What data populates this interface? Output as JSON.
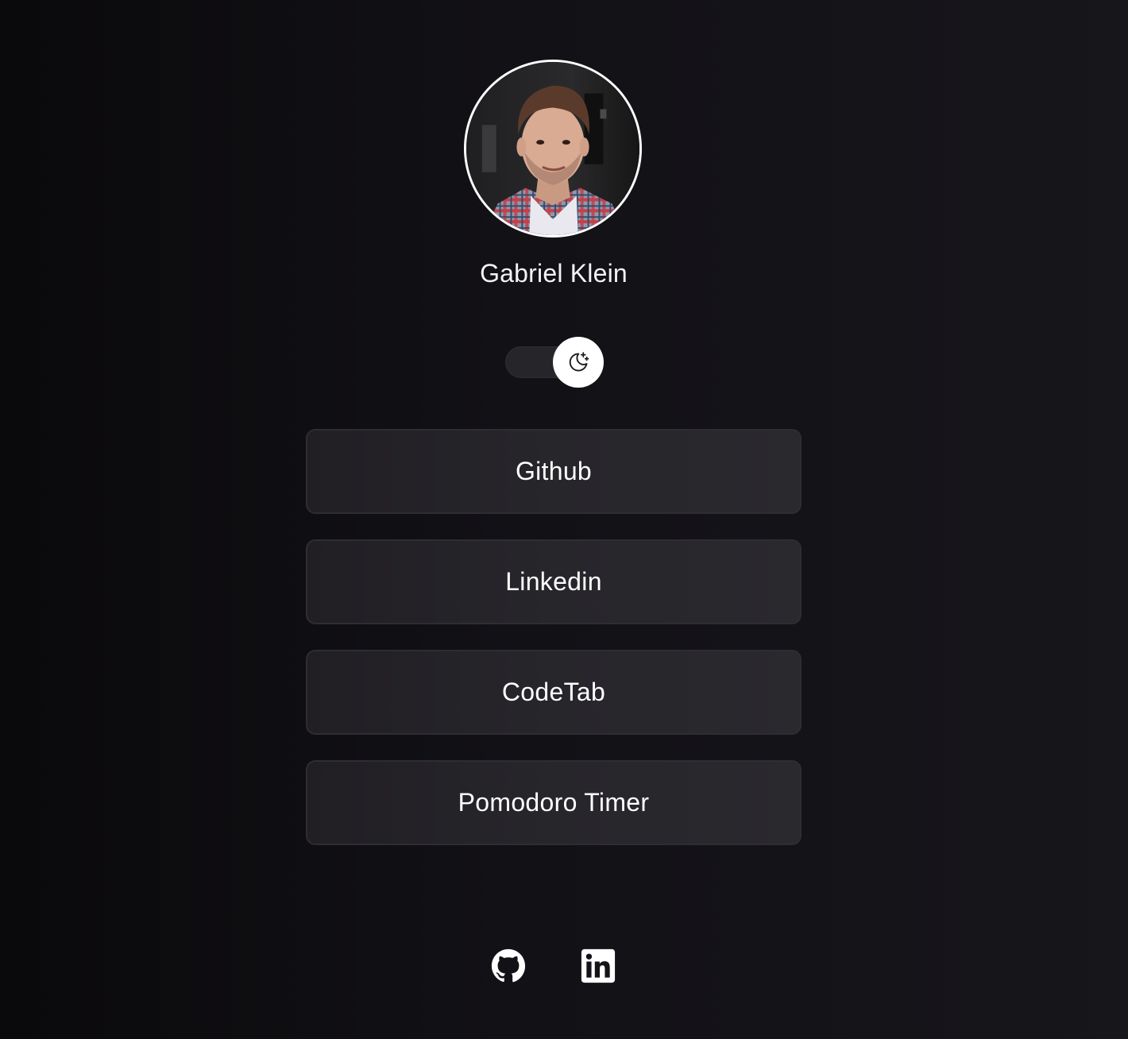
{
  "profile": {
    "name": "Gabriel Klein",
    "avatar_icon": "profile-photo"
  },
  "theme_toggle": {
    "state": "dark",
    "icon": "moon-stars-icon"
  },
  "links": [
    {
      "label": "Github"
    },
    {
      "label": "Linkedin"
    },
    {
      "label": "CodeTab"
    },
    {
      "label": "Pomodoro Timer"
    }
  ],
  "footer": {
    "icons": [
      "github-icon",
      "linkedin-icon"
    ]
  },
  "colors": {
    "background": "#121116",
    "button_bg": "#27262b",
    "button_border": "#2e2d33",
    "text": "#ffffff",
    "toggle_knob": "#ffffff"
  }
}
